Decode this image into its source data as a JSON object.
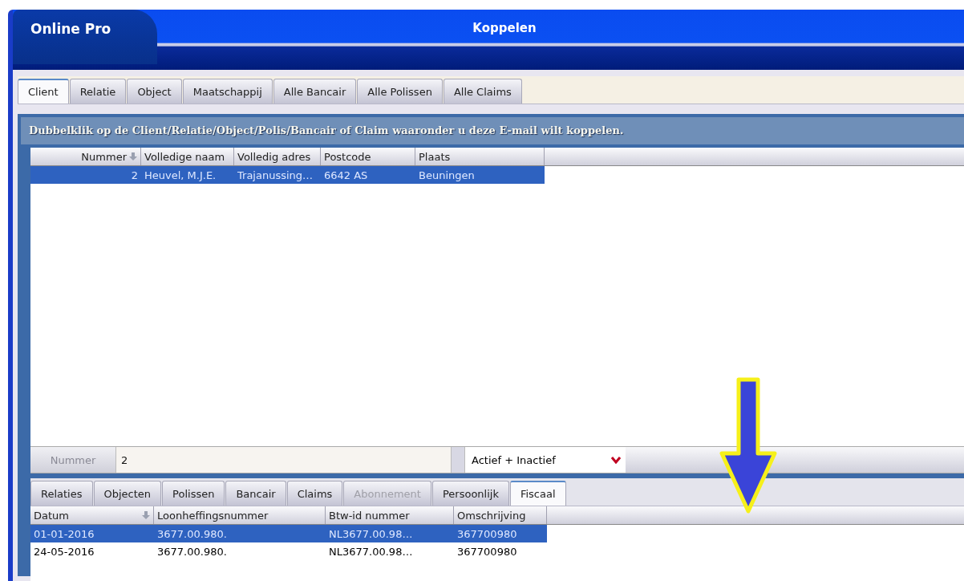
{
  "window": {
    "app_name": "Online Pro",
    "title": "Koppelen"
  },
  "tabs": [
    {
      "label": "Client",
      "selected": true
    },
    {
      "label": "Relatie",
      "selected": false
    },
    {
      "label": "Object",
      "selected": false
    },
    {
      "label": "Maatschappij",
      "selected": false
    },
    {
      "label": "Alle Bancair",
      "selected": false
    },
    {
      "label": "Alle Polissen",
      "selected": false
    },
    {
      "label": "Alle Claims",
      "selected": false
    }
  ],
  "instruction": "Dubbelklik op de Client/Relatie/Object/Polis/Bancair of Claim waaronder u deze E-mail wilt koppelen.",
  "upper_table": {
    "columns": [
      {
        "label": "Nummer",
        "sorted": true
      },
      {
        "label": "Volledige naam",
        "sorted": false
      },
      {
        "label": "Volledig adres",
        "sorted": false
      },
      {
        "label": "Postcode",
        "sorted": false
      },
      {
        "label": "Plaats",
        "sorted": false
      }
    ],
    "rows": [
      {
        "cells": [
          "2",
          "Heuvel, M.J.E.",
          "Trajanussing…",
          "6642 AS",
          "Beuningen"
        ],
        "selected": true
      }
    ]
  },
  "filter": {
    "label": "Nummer",
    "value": "2",
    "status_select": "Actief + Inactief"
  },
  "lower_tabs": [
    {
      "label": "Relaties",
      "selected": false,
      "disabled": false
    },
    {
      "label": "Objecten",
      "selected": false,
      "disabled": false
    },
    {
      "label": "Polissen",
      "selected": false,
      "disabled": false
    },
    {
      "label": "Bancair",
      "selected": false,
      "disabled": false
    },
    {
      "label": "Claims",
      "selected": false,
      "disabled": false
    },
    {
      "label": "Abonnement",
      "selected": false,
      "disabled": true
    },
    {
      "label": "Persoonlijk",
      "selected": false,
      "disabled": false
    },
    {
      "label": "Fiscaal",
      "selected": true,
      "disabled": false
    }
  ],
  "lower_table": {
    "columns": [
      {
        "label": "Datum",
        "sorted": true
      },
      {
        "label": "Loonheffingsnummer",
        "sorted": false
      },
      {
        "label": "Btw-id nummer",
        "sorted": false
      },
      {
        "label": "Omschrijving",
        "sorted": false
      }
    ],
    "rows": [
      {
        "cells": [
          "01-01-2016",
          "3677.00.980.",
          "NL3677.00.98…",
          "367700980"
        ],
        "selected": true
      },
      {
        "cells": [
          "24-05-2016",
          "3677.00.980.",
          "NL3677.00.98…",
          "367700980"
        ],
        "selected": false
      }
    ]
  }
}
